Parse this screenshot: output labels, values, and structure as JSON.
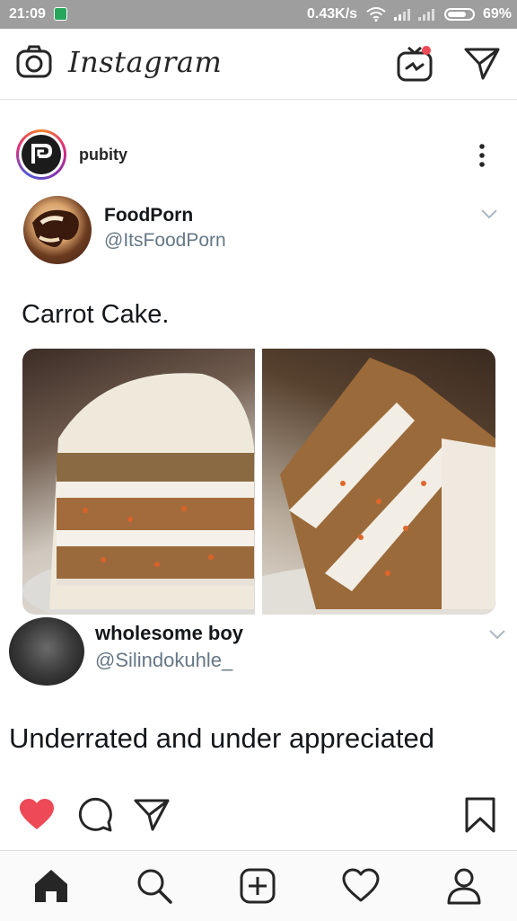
{
  "status_bar": {
    "time": "21:09",
    "network_speed": "0.43K/s",
    "battery": "69%"
  },
  "app_bar": {
    "logo": "Instagram",
    "notification_color": "#ed4956"
  },
  "post": {
    "username": "pubity",
    "ring_colors": [
      "#f58529",
      "#dd2a7b",
      "#8134af",
      "#515bd4"
    ],
    "tweet": {
      "name": "FoodPorn",
      "handle": "@ItsFoodPorn",
      "text": "Carrot Cake."
    },
    "reply": {
      "name": "wholesome boy",
      "handle": "@Silindokuhle_",
      "text": "Underrated and under appreciated"
    },
    "liked": true,
    "like_color": "#ed4956"
  },
  "icons": {
    "camera": "camera-icon",
    "igtv": "igtv-icon",
    "direct": "paper-plane-icon",
    "more": "more-vertical-icon",
    "like": "heart-filled-icon",
    "comment": "comment-icon",
    "share": "paper-plane-icon",
    "save": "bookmark-icon",
    "home": "home-icon",
    "search": "search-icon",
    "new_post": "plus-square-icon",
    "activity": "heart-icon",
    "profile": "person-icon"
  }
}
